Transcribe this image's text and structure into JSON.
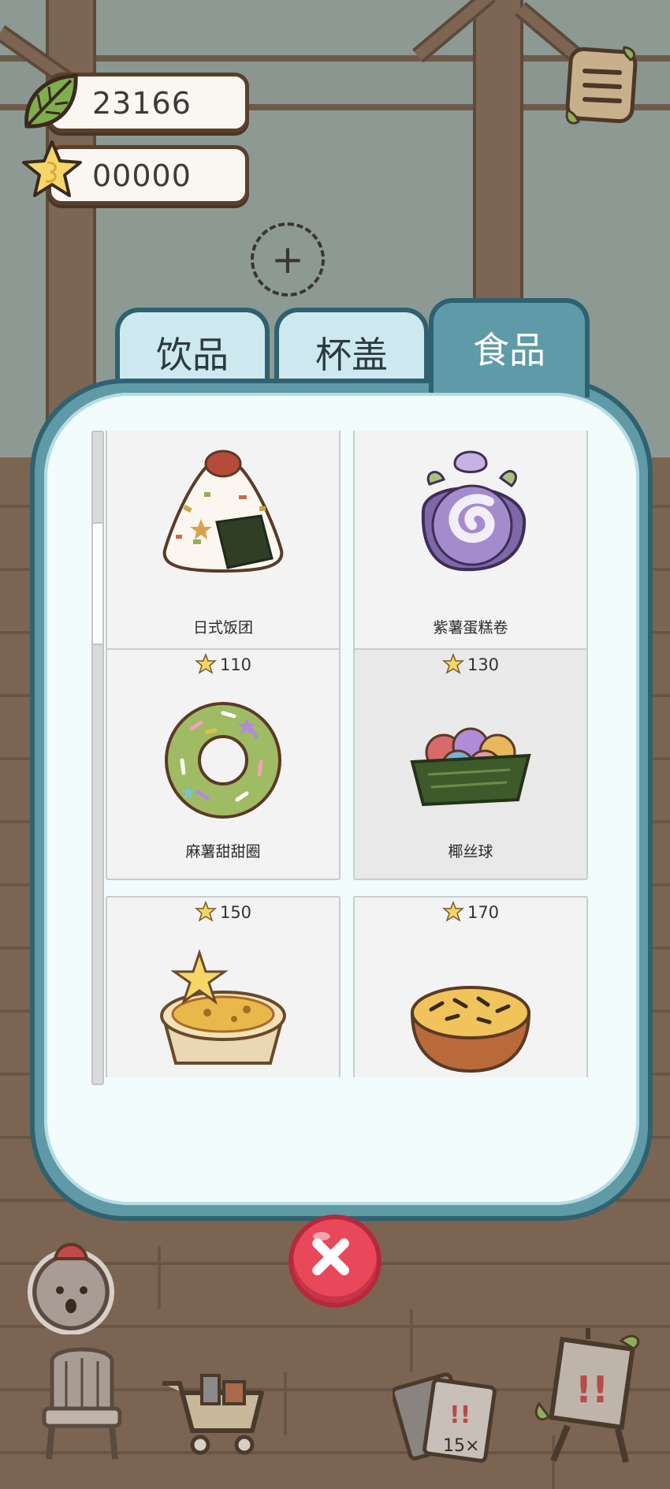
{
  "currency": {
    "leaves": "23166",
    "stars": "00000"
  },
  "tabs": [
    {
      "label": "饮品",
      "active": false
    },
    {
      "label": "杯盖",
      "active": false
    },
    {
      "label": "食品",
      "active": true
    }
  ],
  "items": [
    {
      "name": "日式饭团",
      "price": "",
      "icon": "onigiri-icon"
    },
    {
      "name": "紫薯蛋糕卷",
      "price": "",
      "icon": "purple-cake-roll-icon"
    },
    {
      "name": "麻薯甜甜圈",
      "price": "110",
      "icon": "mochi-donut-icon"
    },
    {
      "name": "椰丝球",
      "price": "130",
      "icon": "coconut-ball-icon"
    },
    {
      "name": "",
      "price": "150",
      "icon": "egg-tart-icon"
    },
    {
      "name": "",
      "price": "170",
      "icon": "baked-potato-icon"
    }
  ],
  "colors": {
    "panel": "#5f9aa6",
    "panel_border": "#2f6270",
    "tab_inactive": "#cde9ef",
    "tab_active": "#5e9aa7",
    "close": "#e8485a",
    "star": "#f5d769"
  },
  "icons": {
    "menu": "menu-list-icon",
    "leaf": "leaf-currency-icon",
    "star": "star-currency-icon",
    "add": "plus-icon",
    "close": "close-icon",
    "bottom": [
      "customer-icon",
      "chair-icon",
      "shopping-cart-icon",
      "card-pack-icon",
      "event-board-icon"
    ]
  },
  "bottom_bar": {
    "card_pack_count": "15×"
  }
}
